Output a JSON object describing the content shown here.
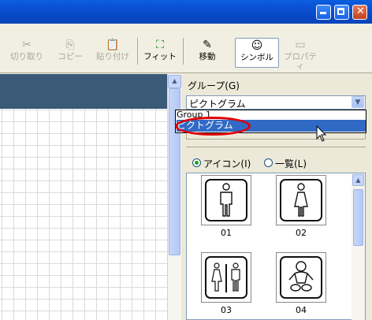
{
  "toolbar": {
    "cut": "切り取り",
    "copy": "コピー",
    "paste": "貼り付け",
    "fit": "フィット",
    "move": "移動",
    "symbol": "シンボル",
    "properties": "プロパティ"
  },
  "panel": {
    "group_label": "グループ(G)",
    "group_value": "ピクトグラム",
    "dropdown_options": [
      "Group 1",
      "ピクトグラム"
    ],
    "selected_option": "ピクトグラム",
    "view_icon_label": "アイコン(I)",
    "view_list_label": "一覧(L)",
    "view_selected": "アイコン(I)",
    "icons": [
      {
        "label": "01",
        "icon": "man-pictogram-icon"
      },
      {
        "label": "02",
        "icon": "woman-pictogram-icon"
      },
      {
        "label": "03",
        "icon": "restroom-pictogram-icon"
      },
      {
        "label": "04",
        "icon": "baby-pictogram-icon"
      }
    ]
  },
  "colors": {
    "titlebar": "#0a4ed0",
    "selection": "#316ac5",
    "highlight": "#e00000"
  }
}
